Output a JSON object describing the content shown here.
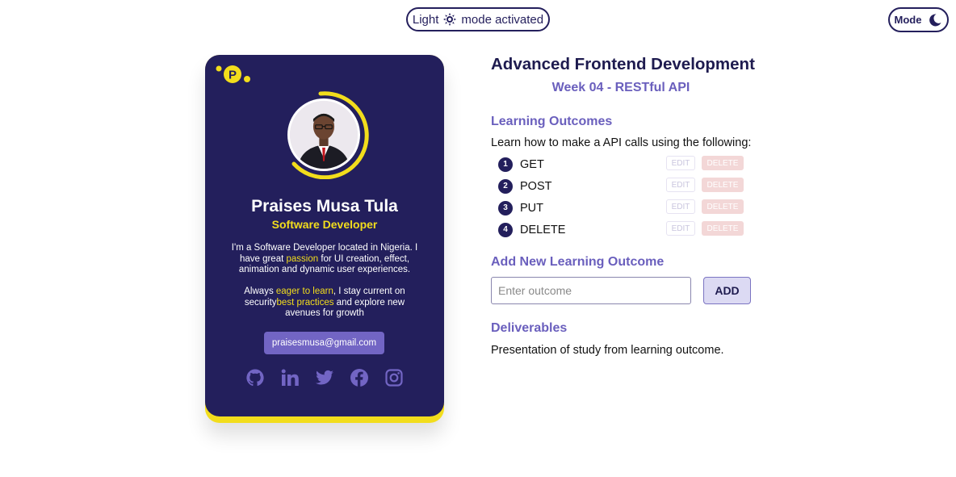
{
  "theme_status": {
    "prefix": "Light",
    "suffix": "mode activated",
    "icon": "sun-icon"
  },
  "mode_toggle": {
    "label": "Mode",
    "icon": "moon-icon"
  },
  "colors": {
    "primary": "#231f5c",
    "accent": "#f2dd1c",
    "secondary": "#6a5fbd",
    "delete": "#f3d7d7"
  },
  "profile": {
    "logo_letter": "P",
    "name": "Praises Musa Tula",
    "role": "Software Developer",
    "bio1": {
      "a": "I'm a Software Developer located in Nigeria. I have great ",
      "hl": "passion",
      "b": " for UI creation, effect, animation and dynamic user experiences."
    },
    "bio2": {
      "a": "Always ",
      "hl1": "eager to learn",
      "b": ", I stay current on security",
      "hl2": "best practices",
      "c": " and explore new avenues for growth"
    },
    "email": "praisesmusa@gmail.com",
    "socials": [
      "github-icon",
      "linkedin-icon",
      "twitter-icon",
      "facebook-icon",
      "instagram-icon"
    ]
  },
  "course": {
    "title": "Advanced Frontend Development",
    "week": "Week 04 - RESTful API",
    "outcomes_heading": "Learning Outcomes",
    "intro": "Learn how to make a API calls using the following:",
    "outcomes": [
      {
        "num": "1",
        "label": "GET"
      },
      {
        "num": "2",
        "label": "POST"
      },
      {
        "num": "3",
        "label": "PUT"
      },
      {
        "num": "4",
        "label": "DELETE"
      }
    ],
    "edit_label": "EDIT",
    "delete_label": "DELETE",
    "add_heading": "Add New Learning Outcome",
    "input_placeholder": "Enter outcome",
    "add_label": "ADD",
    "deliverables_heading": "Deliverables",
    "deliverables_text": "Presentation of study from learning outcome."
  }
}
